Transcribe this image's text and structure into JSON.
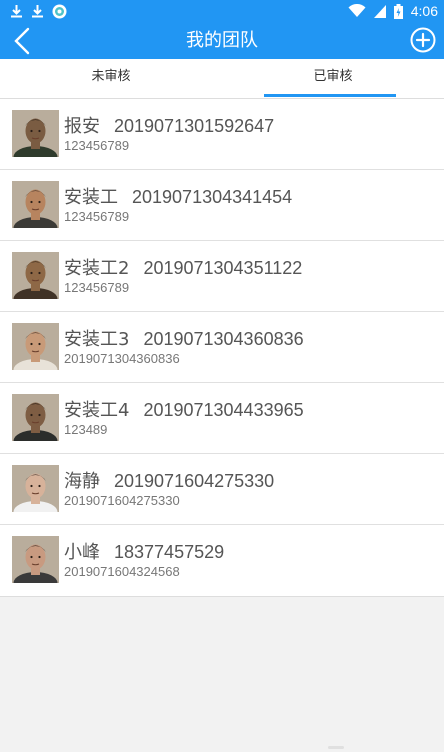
{
  "status_bar": {
    "time": "4:06",
    "colors": {
      "background": "#2196f3",
      "foreground": "#ffffff"
    },
    "icons": [
      "download-icon",
      "download-icon",
      "app-notification-icon",
      "wifi-icon",
      "signal-icon",
      "battery-icon"
    ]
  },
  "header": {
    "title": "我的团队",
    "back_icon": "chevron-left-icon",
    "add_icon": "plus-circle-icon"
  },
  "tabs": [
    {
      "label": "未审核",
      "active": false
    },
    {
      "label": "已审核",
      "active": true
    }
  ],
  "members": [
    {
      "name": "报安",
      "id": "2019071301592647",
      "sub": "123456789",
      "skin": "#7a5c42",
      "shirt": "#2f3b2c",
      "hair": "#1f1a16"
    },
    {
      "name": "安装工",
      "id": "2019071304341454",
      "sub": "123456789",
      "skin": "#b7845f",
      "shirt": "#3b3a36",
      "hair": "#2b2420"
    },
    {
      "name": "安装工2",
      "id": "2019071304351122",
      "sub": "123456789",
      "skin": "#8e6846",
      "shirt": "#403226",
      "hair": "#1d1812"
    },
    {
      "name": "安装工3",
      "id": "2019071304360836",
      "sub": "2019071304360836",
      "skin": "#c89a78",
      "shirt": "#e8e2d8",
      "hair": "#1a1613"
    },
    {
      "name": "安装工4",
      "id": "2019071304433965",
      "sub": "123489",
      "skin": "#7e5d43",
      "shirt": "#2b2d2b",
      "hair": "#15120f"
    },
    {
      "name": "海静",
      "id": "2019071604275330",
      "sub": "2019071604275330",
      "skin": "#d7b29a",
      "shirt": "#f1f1f1",
      "hair": "#201a17"
    },
    {
      "name": "小峰",
      "id": "18377457529",
      "sub": "2019071604324568",
      "skin": "#c89a80",
      "shirt": "#3a3a3a",
      "hair": "#141210"
    }
  ]
}
